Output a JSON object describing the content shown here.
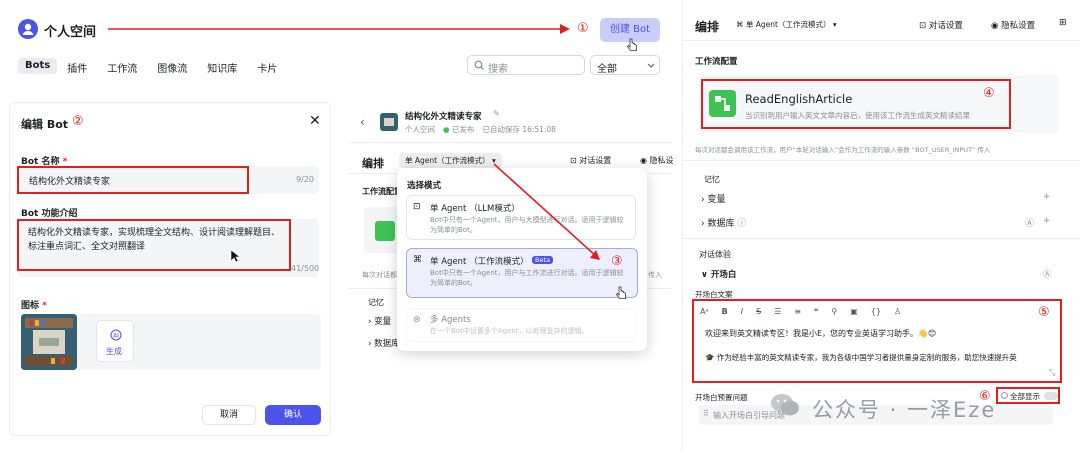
{
  "header": {
    "title": "个人空间",
    "create_bot": "创建 Bot",
    "tabs": [
      "Bots",
      "插件",
      "工作流",
      "图像流",
      "知识库",
      "卡片"
    ],
    "search_placeholder": "搜索",
    "filter_value": "全部"
  },
  "markers": {
    "m1": "①",
    "m2": "②",
    "m3": "③",
    "m4": "④",
    "m5": "⑤",
    "m6": "⑥"
  },
  "edit_bot": {
    "title": "编辑 Bot",
    "name_label": "Bot 名称",
    "name_value": "结构化外文精读专家",
    "name_count": "9/20",
    "intro_label": "Bot 功能介绍",
    "intro_value": "结构化外文精读专家，实现梳理全文结构、设计阅读理解题目、标注重点词汇、全文对照翻译",
    "intro_count": "41/500",
    "icon_label": "图标",
    "generate": "生成",
    "cancel": "取消",
    "confirm": "确认"
  },
  "mid": {
    "bot_name": "结构化外文精读专家",
    "space": "个人空间",
    "status": "已发布",
    "autosave": "已自动保存 16:51:08",
    "arrange": "编排",
    "agent_mode": "单 Agent（工作流模式）",
    "dialog_settings": "对话设置",
    "privacy": "隐私设",
    "workflow_config": "工作流配置",
    "note": "每次对话都",
    "memory": "记忆",
    "variables": "变量",
    "database": "数据库",
    "enter": "传入"
  },
  "mode_menu": {
    "title": "选择模式",
    "options": [
      {
        "name": "单 Agent （LLM模式）",
        "desc": "Bot中只有一个Agent，用户与大模型进行对话。适用于逻辑较为简单的Bot。",
        "beta": ""
      },
      {
        "name": "单 Agent （工作流模式）",
        "desc": "Bot中只有一个Agent，用户与工作流进行对话。适用于逻辑较为简单的Bot。",
        "beta": "Beta"
      },
      {
        "name": "多 Agents",
        "desc": "在一个Bot中设置多个Agent，以处理复杂的逻辑。",
        "beta": ""
      }
    ]
  },
  "right": {
    "arrange": "编排",
    "agent_mode": "单 Agent（工作流模式）",
    "dialog_settings": "对话设置",
    "privacy": "隐私设置",
    "workflow_config": "工作流配置",
    "workflow_name": "ReadEnglishArticle",
    "workflow_desc": "当识别到用户输入英文文章内容后，使用该工作流生成英文精读结果",
    "note": "每次对话都会调用该工作流，用户“本轮对话输入”会作为工作流的输入参数 “BOT_USER_INPUT” 传入",
    "memory": "记忆",
    "variables": "变量",
    "database": "数据库",
    "dialog_exp": "对话体验",
    "opening": "开场白",
    "opening_text_label": "开场白文案",
    "opening_line1": "欢迎来到英文精读专区！我是小E，您的专业英语学习助手。👋😊",
    "opening_line2": "🎓 作为经验丰富的英文精读专家，我为各级中国学习者提供量身定制的服务，助您快速提升英",
    "preset_label": "开场白预置问题",
    "show_all": "全部显示",
    "preset_placeholder": "输入开场白引导问题"
  },
  "watermark": "公众号 · 一泽Eze",
  "colors": {
    "accent": "#4d53e8",
    "green": "#3ec254",
    "red": "#e02020"
  }
}
